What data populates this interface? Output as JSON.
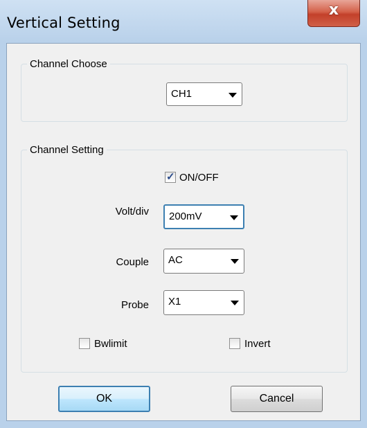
{
  "window": {
    "title": "Vertical Setting",
    "close_label": "x"
  },
  "channel_choose": {
    "legend": "Channel Choose",
    "selected": "CH1"
  },
  "channel_setting": {
    "legend": "Channel Setting",
    "on_off": {
      "label": "ON/OFF",
      "checked": true
    },
    "volt_div": {
      "label": "Volt/div",
      "value": "200mV"
    },
    "couple": {
      "label": "Couple",
      "value": "AC"
    },
    "probe": {
      "label": "Probe",
      "value": "X1"
    },
    "bwlimit": {
      "label": "Bwlimit",
      "checked": false
    },
    "invert": {
      "label": "Invert",
      "checked": false
    }
  },
  "buttons": {
    "ok": "OK",
    "cancel": "Cancel"
  },
  "colors": {
    "focus_border": "#3c7fb1",
    "close_button": "#c3402a"
  }
}
